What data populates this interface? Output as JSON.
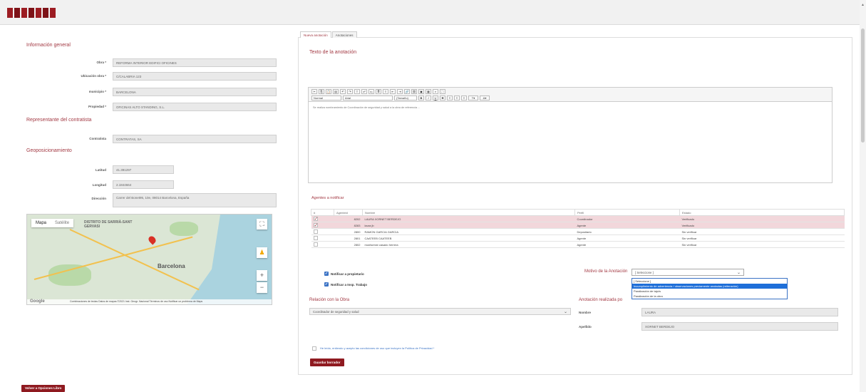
{
  "left": {
    "general_title": "Información general",
    "obra_label": "Obra *",
    "obra_value": "REFORMA INTERIOR EDIFICI OFICINES",
    "ubicacion_label": "Ubicación obra *",
    "ubicacion_value": "C/CALABRIA 123",
    "municipio_label": "municipio *",
    "municipio_value": "BARCELONA",
    "propiedad_label": "Propiedad *",
    "propiedad_value": "OFICINAS ALTO STANDING, S.L.",
    "contratista_title": "Representante del contratista",
    "contratista_label": "Contratista",
    "contratista_value": "CONTRATAS, SA",
    "geo_title": "Geoposicionamiento",
    "latitud_label": "Latitud",
    "latitud_value": "41.391297",
    "longitud_label": "Longitud",
    "longitud_value": "2.1844664",
    "direccion_label": "Dirección",
    "direccion_value": "Carrer del Bonet95, 10e, 08014 Barcelona, España"
  },
  "map": {
    "tab_map": "Mapa",
    "tab_satellite": "Satélite",
    "label_district": "DISTRITO DE SARRIÀ-SANT GERVASI",
    "label_city": "Barcelona",
    "footer": "Combinaciones de teclas   Datos de mapas ©2021 Inst. Geogr. Nacional   Términos de uso   Notificar un problema de Maps",
    "google": "Google",
    "zoom_in": "+",
    "zoom_out": "−",
    "fullscreen": "⛶"
  },
  "tabs": [
    "Nueva anotación",
    "Anotaciones"
  ],
  "editor": {
    "title": "Texto de la anotación",
    "style_select": "Normal",
    "font_select": "Arial",
    "size_select": "(Tamaño) ",
    "text": "Se realiza nombramiento de Coordinación de seguridad y salud a la obra de referencia ..."
  },
  "agents": {
    "title": "Agentes a notificar",
    "headers": [
      "#",
      "Agenteid",
      "Nombre",
      "Perfil",
      "Estado"
    ],
    "rows": [
      {
        "checked": true,
        "id": "8202",
        "name": "LAURA XORNET BERDEJO",
        "perfil": "Coordinador",
        "estado": "Verificado"
      },
      {
        "checked": true,
        "id": "8283",
        "name": "laura jb",
        "perfil": "Agente",
        "estado": "Verificado"
      },
      {
        "checked": false,
        "id": "2800",
        "name": "RAMON GARCIA GARCIA",
        "perfil": "Depositario",
        "estado": "Sin verificar"
      },
      {
        "checked": false,
        "id": "2801",
        "name": "CAATEEB CAATEEB",
        "perfil": "Agente",
        "estado": "Sin verificar"
      },
      {
        "checked": false,
        "id": "2802",
        "name": "montserrat casado herrera",
        "perfil": "Agente",
        "estado": "Sin verificar"
      }
    ]
  },
  "notify": {
    "propietario": "Notificar a propietario",
    "insp_trabajo": "Notificar a Insp. Trabajo"
  },
  "motivo": {
    "label": "Motivo de la Anotación",
    "selected": "[ Seleccione ]",
    "options": [
      "[ Seleccione ]",
      "Incumplimiento de advertencia / observaciones previamente anotadas (reiteración)",
      "Paralización de tajo/s",
      "Paralización de la obra"
    ]
  },
  "relacion": {
    "title": "Relación con la Obra",
    "selected": "Coordinador de seguridad y salud"
  },
  "realizada": {
    "title": "Anotación realizada po",
    "nombre_label": "Nombre",
    "nombre_value": "LAURA",
    "apellido_label": "Apellido",
    "apellido_value": "XORNET BERDEJO"
  },
  "privacy": "He leído, entiendo y acepto las condiciones de uso que incluyen la Política de Privacidad *",
  "buttons": {
    "guardar": "Guardar borrador",
    "volver": "Volver a Opciones Libro"
  },
  "colors": {
    "brand": "#9c1c22",
    "accent_text": "#a33a44",
    "selection": "#f2d7db",
    "link": "#3b73c5"
  }
}
